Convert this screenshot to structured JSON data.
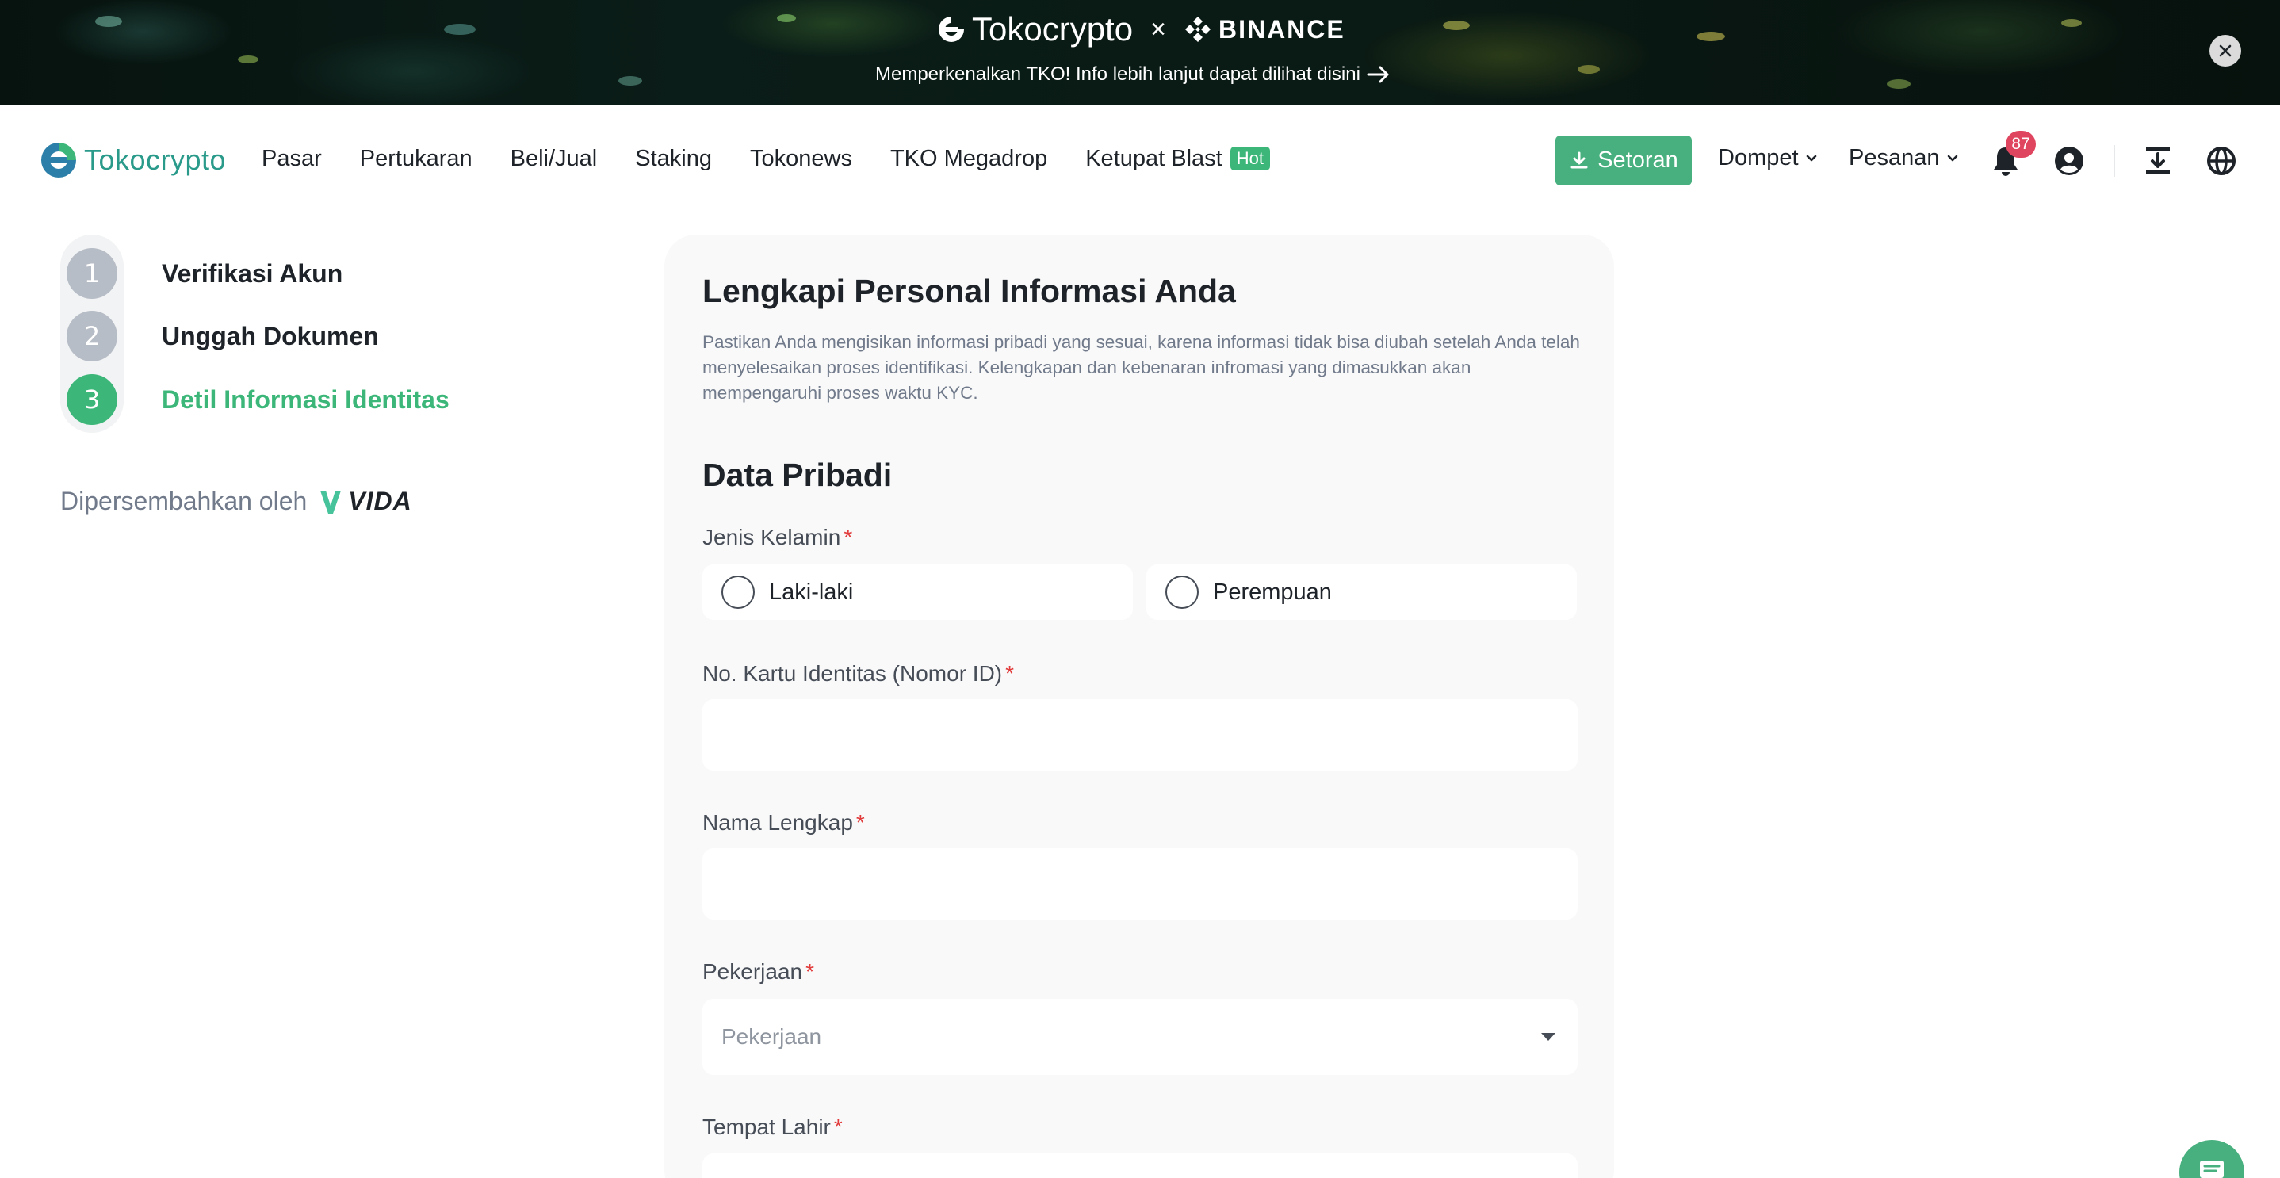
{
  "banner": {
    "brand_left": "Tokocrypto",
    "brand_separator": "×",
    "brand_right": "BINANCE",
    "announcement": "Memperkenalkan TKO! Info lebih lanjut dapat dilihat disini",
    "close_icon": "close-icon"
  },
  "nav": {
    "logo": "Tokocrypto",
    "links": [
      "Pasar",
      "Pertukaran",
      "Beli/Jual",
      "Staking",
      "Tokonews",
      "TKO Megadrop",
      "Ketupat Blast"
    ],
    "hot_badge": "Hot",
    "deposit_label": "Setoran",
    "wallet_label": "Dompet",
    "orders_label": "Pesanan",
    "notification_count": "87",
    "icons": [
      "bell-icon",
      "user-icon",
      "download-icon",
      "globe-icon"
    ]
  },
  "steps": {
    "items": [
      {
        "number": "1",
        "label": "Verifikasi Akun",
        "active": false
      },
      {
        "number": "2",
        "label": "Unggah Dokumen",
        "active": false
      },
      {
        "number": "3",
        "label": "Detil Informasi Identitas",
        "active": true
      }
    ],
    "powered_by": "Dipersembahkan oleh",
    "partner": "VIDA"
  },
  "form": {
    "title": "Lengkapi Personal Informasi Anda",
    "description": "Pastikan Anda mengisikan informasi pribadi yang sesuai, karena informasi tidak bisa diubah setelah Anda telah menyelesaikan proses identifikasi. Kelengkapan dan kebenaran infromasi yang dimasukkan akan mempengaruhi proses waktu KYC.",
    "section": "Data Pribadi",
    "required_mark": "*",
    "gender": {
      "label": "Jenis Kelamin",
      "options": [
        "Laki-laki",
        "Perempuan"
      ]
    },
    "id_number": {
      "label": "No. Kartu Identitas (Nomor ID)",
      "value": "",
      "placeholder": ""
    },
    "full_name": {
      "label": "Nama Lengkap",
      "value": "",
      "placeholder": ""
    },
    "occupation": {
      "label": "Pekerjaan",
      "placeholder": "Pekerjaan"
    },
    "birth_place": {
      "label": "Tempat Lahir"
    }
  },
  "colors": {
    "brand_green": "#3cb779",
    "button_green": "#47b07e",
    "required_red": "#e23b3b",
    "badge_red": "#e0455f"
  }
}
